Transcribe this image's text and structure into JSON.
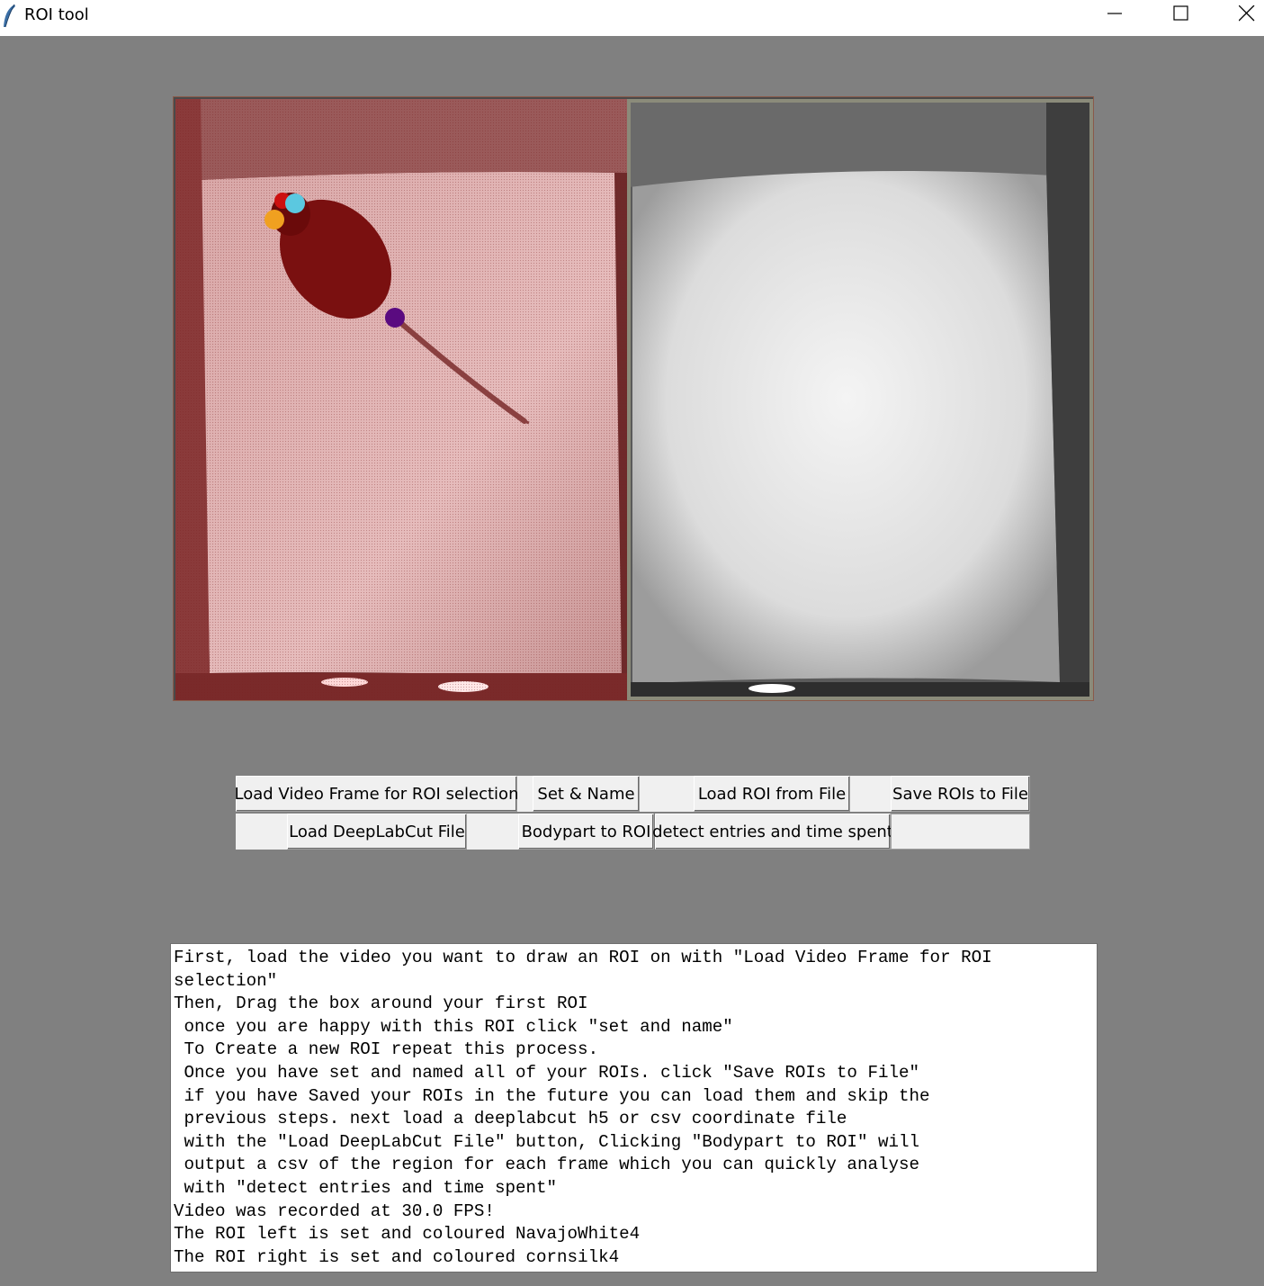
{
  "window": {
    "title": "ROI tool"
  },
  "buttons": {
    "load_video": "Load Video Frame for ROI selection",
    "set_name": "Set & Name",
    "load_roi": "Load ROI from File",
    "save_rois": "Save ROIs to File",
    "load_dlc": "Load DeepLabCut File",
    "bodypart_roi": "Bodypart to ROI",
    "detect_entries": "detect entries and time spent"
  },
  "log": {
    "lines": [
      "First, load the video you want to draw an ROI on with \"Load Video Frame for ROI selection\"",
      "Then, Drag the box around your first ROI",
      " once you are happy with this ROI click \"set and name\"",
      " To Create a new ROI repeat this process.",
      " Once you have set and named all of your ROIs. click \"Save ROIs to File\"",
      " if you have Saved your ROIs in the future you can load them and skip the",
      " previous steps. next load a deeplabcut h5 or csv coordinate file",
      " with the \"Load DeepLabCut File\" button, Clicking \"Bodypart to ROI\" will",
      " output a csv of the region for each frame which you can quickly analyse",
      " with \"detect entries and time spent\"",
      "Video was recorded at 30.0 FPS!",
      "The ROI left is set and coloured NavajoWhite4",
      "The ROI right is set and coloured cornsilk4"
    ]
  },
  "colors": {
    "background": "#808080",
    "roi_left_tint": "#c98a8a",
    "marker_cyan": "#5bc8e0",
    "marker_orange": "#f0a020",
    "marker_red": "#cc1010",
    "marker_purple": "#5a0a80"
  },
  "icons": {
    "app": "feather-icon",
    "minimize": "minimize-icon",
    "maximize": "maximize-icon",
    "close": "close-icon"
  }
}
